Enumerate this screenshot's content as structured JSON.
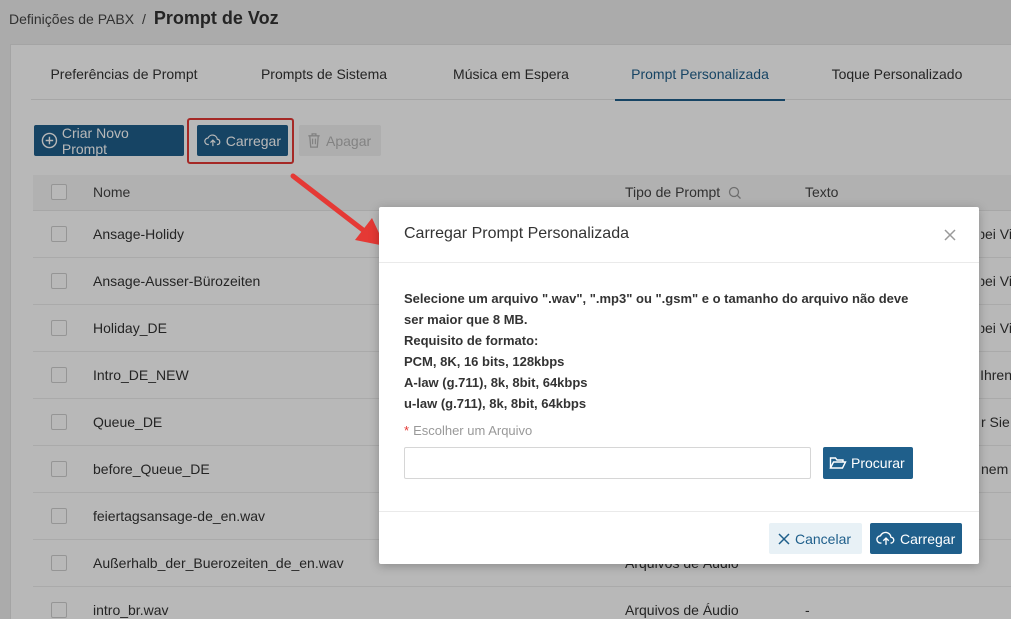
{
  "breadcrumb": {
    "parent": "Definições de PABX",
    "separator": "/",
    "current": "Prompt de Voz"
  },
  "tabs": [
    {
      "label": "Preferências de Prompt",
      "active": false
    },
    {
      "label": "Prompts de Sistema",
      "active": false
    },
    {
      "label": "Música em Espera",
      "active": false
    },
    {
      "label": "Prompt Personalizada",
      "active": true
    },
    {
      "label": "Toque Personalizado",
      "active": false
    }
  ],
  "toolbar": {
    "create_label": "Criar Novo Prompt",
    "upload_label": "Carregar",
    "delete_label": "Apagar"
  },
  "table": {
    "columns": {
      "name": "Nome",
      "type": "Tipo de Prompt",
      "text": "Texto"
    },
    "rows": [
      {
        "name": "Ansage-Holidy",
        "type": "",
        "text": "pei Vi"
      },
      {
        "name": "Ansage-Ausser-Bürozeiten",
        "type": "",
        "text": "pei Vi"
      },
      {
        "name": "Holiday_DE",
        "type": "",
        "text": "pei Vi"
      },
      {
        "name": "Intro_DE_NEW",
        "type": "",
        "text": "Ihren"
      },
      {
        "name": "Queue_DE",
        "type": "",
        "text": "r Sie"
      },
      {
        "name": "before_Queue_DE",
        "type": "",
        "text": "nem"
      },
      {
        "name": "feiertagsansage-de_en.wav",
        "type": "",
        "text": ""
      },
      {
        "name": "Außerhalb_der_Buerozeiten_de_en.wav",
        "type": "Arquivos de Áudio",
        "text": ""
      },
      {
        "name": "intro_br.wav",
        "type": "Arquivos de Áudio",
        "text": "-"
      }
    ]
  },
  "modal": {
    "title": "Carregar Prompt Personalizada",
    "info_lines": [
      "Selecione um arquivo \".wav\", \".mp3\" ou \".gsm\" e o tamanho do arquivo não deve",
      "ser maior que 8 MB.",
      "Requisito de formato:",
      "PCM, 8K, 16 bits, 128kbps",
      "A-law (g.711), 8k, 8bit, 64kbps",
      "u-law (g.711), 8k, 8bit, 64kbps"
    ],
    "field_required_mark": "*",
    "field_label": "Escolher um Arquivo",
    "file_value": "",
    "browse_label": "Procurar",
    "cancel_label": "Cancelar",
    "upload_label": "Carregar"
  },
  "colors": {
    "primary": "#1f5f8b",
    "highlight": "#e53935",
    "cancel_bg": "#e8f1f6"
  }
}
